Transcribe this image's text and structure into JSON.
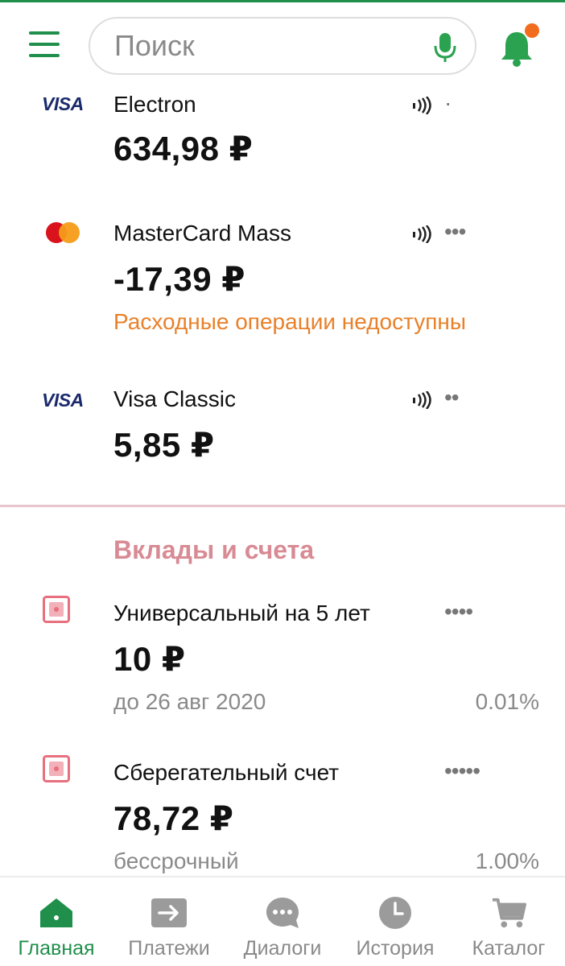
{
  "colors": {
    "brand_green": "#1f8f4b",
    "warning_orange": "#e8812a",
    "section_pink": "#d88b94",
    "notification_dot": "#f26c1d"
  },
  "header": {
    "menu_icon": "hamburger-menu-icon",
    "search": {
      "placeholder": "Поиск",
      "value": "",
      "mic_icon": "microphone-icon"
    },
    "notifications_icon": "bell-icon",
    "has_unread": true
  },
  "cards": [
    {
      "brand": "VISA",
      "name": "Electron",
      "balance": "634,98 ₽",
      "masked_number": "·"
    },
    {
      "brand": "MasterCard",
      "name": "MasterCard Mass",
      "balance": "-17,39 ₽",
      "masked_number": "•••",
      "warning": "Расходные операции недоступны"
    },
    {
      "brand": "VISA",
      "name": "Visa Classic",
      "balance": "5,85 ₽",
      "masked_number": "••"
    }
  ],
  "deposits_section": {
    "title": "Вклады и счета",
    "items": [
      {
        "name": "Универсальный на 5 лет",
        "balance": "10 ₽",
        "term": "до 26 авг 2020",
        "rate": "0.01%",
        "masked_number": "••••"
      },
      {
        "name": "Сберегательный счет",
        "balance": "78,72 ₽",
        "term": "бессрочный",
        "rate": "1.00%",
        "masked_number": "•••••"
      }
    ]
  },
  "bottom_nav": [
    {
      "label": "Главная",
      "icon": "home-icon",
      "active": true
    },
    {
      "label": "Платежи",
      "icon": "payments-arrow-icon",
      "active": false
    },
    {
      "label": "Диалоги",
      "icon": "chat-bubble-icon",
      "active": false
    },
    {
      "label": "История",
      "icon": "clock-icon",
      "active": false
    },
    {
      "label": "Каталог",
      "icon": "cart-icon",
      "active": false
    }
  ]
}
